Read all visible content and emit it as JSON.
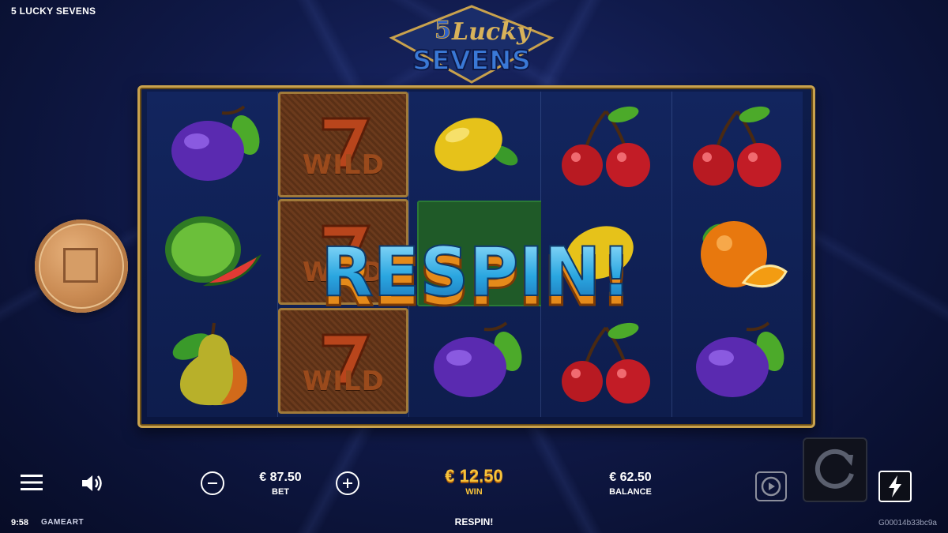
{
  "game_title": "5 LUCKY SEVENS",
  "logo": {
    "number": "5",
    "line1": "Lucky",
    "line2": "SEVENS"
  },
  "reels": [
    [
      "plum",
      "watermelon",
      "pear"
    ],
    [
      "wild",
      "wild",
      "wild"
    ],
    [
      "lemon",
      "bar",
      "plum"
    ],
    [
      "cherry",
      "lemon",
      "cherry"
    ],
    [
      "cherry",
      "orange",
      "plum"
    ]
  ],
  "wild_label": "WILD",
  "banner_text": "RESPIN!",
  "bottom": {
    "bet_value": "€ 87.50",
    "bet_label": "BET",
    "win_value": "€ 12.50",
    "win_label": "WIN",
    "balance_value": "€ 62.50",
    "balance_label": "BALANCE",
    "clock": "9:58",
    "provider": "GAMEART",
    "status": "RESPIN!",
    "session_id": "G00014b33bc9a"
  },
  "colors": {
    "gold": "#c9a24d",
    "win": "#f7c23a",
    "banner_blue": "#3ab0e6",
    "banner_orange": "#e58a1a"
  },
  "icons": [
    "menu-icon",
    "sound-icon",
    "minus-icon",
    "plus-icon",
    "stop-icon",
    "autoplay-icon",
    "spin-icon",
    "lightning-icon"
  ]
}
